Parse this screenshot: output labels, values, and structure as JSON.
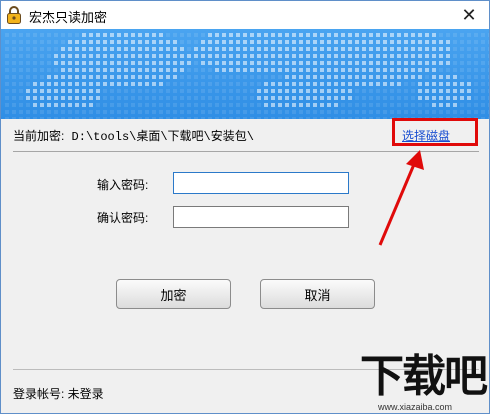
{
  "window": {
    "title": "宏杰只读加密",
    "close_label": "✕"
  },
  "path": {
    "label": "当前加密:",
    "value": "D:\\tools\\桌面\\下载吧\\安装包\\",
    "select_disk": "选择磁盘"
  },
  "form": {
    "input_password_label": "输入密码:",
    "confirm_password_label": "确认密码:",
    "input_password_value": "",
    "confirm_password_value": ""
  },
  "buttons": {
    "encrypt": "加密",
    "cancel": "取消"
  },
  "status": {
    "login": "登录帐号: 未登录"
  },
  "watermark": {
    "brand": "下载吧",
    "url": "www.xiazaiba.com"
  },
  "colors": {
    "banner": "#2f8ee5",
    "link": "#1a4fd1",
    "highlight": "#e00a0a"
  }
}
